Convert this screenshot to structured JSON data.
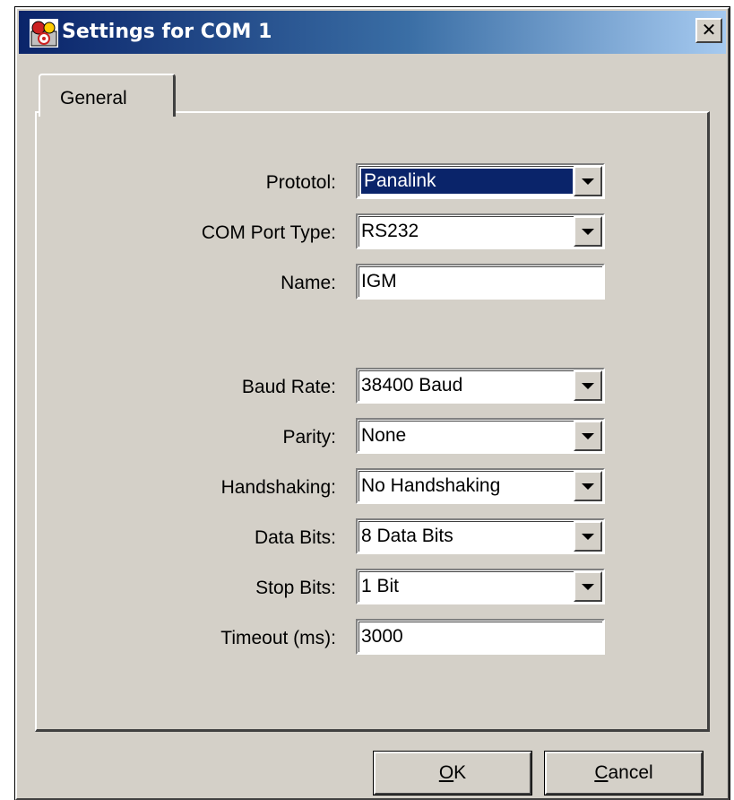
{
  "window": {
    "title": "Settings for COM 1",
    "close_glyph": "✕"
  },
  "tabs": [
    {
      "label": "General"
    }
  ],
  "form": {
    "protocol": {
      "label": "Prototol:",
      "value": "Panalink"
    },
    "com_port_type": {
      "label": "COM Port Type:",
      "value": "RS232"
    },
    "name": {
      "label": "Name:",
      "value": "IGM"
    },
    "baud_rate": {
      "label": "Baud Rate:",
      "value": "38400 Baud"
    },
    "parity": {
      "label": "Parity:",
      "value": "None"
    },
    "handshaking": {
      "label": "Handshaking:",
      "value": "No Handshaking"
    },
    "data_bits": {
      "label": "Data Bits:",
      "value": "8 Data Bits"
    },
    "stop_bits": {
      "label": "Stop Bits:",
      "value": "1 Bit"
    },
    "timeout": {
      "label": "Timeout (ms):",
      "value": "3000"
    }
  },
  "buttons": {
    "ok": {
      "mnemonic": "O",
      "rest": "K"
    },
    "cancel": {
      "mnemonic": "C",
      "rest": "ancel"
    }
  },
  "colors": {
    "title_bar": "#0a246a",
    "dialog_face": "#d4d0c8",
    "selection": "#0a246a"
  }
}
